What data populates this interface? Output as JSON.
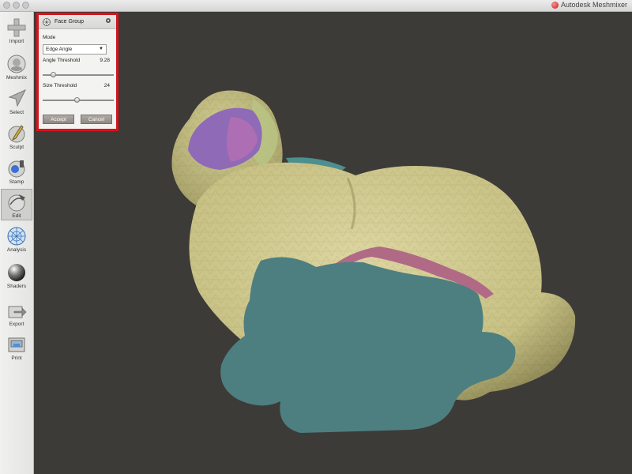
{
  "app": {
    "title": "Autodesk Meshmixer"
  },
  "toolbar": {
    "items": [
      {
        "label": "Import",
        "icon": "import-plus-icon"
      },
      {
        "label": "Meshmix",
        "icon": "meshmix-icon"
      },
      {
        "label": "Select",
        "icon": "select-arrow-icon"
      },
      {
        "label": "Sculpt",
        "icon": "sculpt-brush-icon"
      },
      {
        "label": "Stamp",
        "icon": "stamp-icon"
      },
      {
        "label": "Edit",
        "icon": "edit-icon",
        "active": true
      },
      {
        "label": "Analysis",
        "icon": "analysis-icon"
      },
      {
        "label": "Shaders",
        "icon": "shaders-sphere-icon"
      },
      {
        "label": "Export",
        "icon": "export-icon"
      },
      {
        "label": "Print",
        "icon": "print-icon"
      }
    ]
  },
  "panel": {
    "title": "Face Group",
    "mode_label": "Mode",
    "mode_value": "Edge Angle",
    "angle_label": "Angle Threshold",
    "angle_value": "9.28",
    "angle_fraction": 0.15,
    "size_label": "Size Threshold",
    "size_value": "24",
    "size_fraction": 0.48,
    "accept_label": "Accept",
    "cancel_label": "Cancel"
  },
  "colors": {
    "viewport_bg": "#3d3b38",
    "mesh_main": "#cfc98c",
    "group_teal": "#4d7f80",
    "group_purple": "#8f6ab7",
    "group_pink": "#b06a86",
    "highlight_border": "#d9131a"
  }
}
